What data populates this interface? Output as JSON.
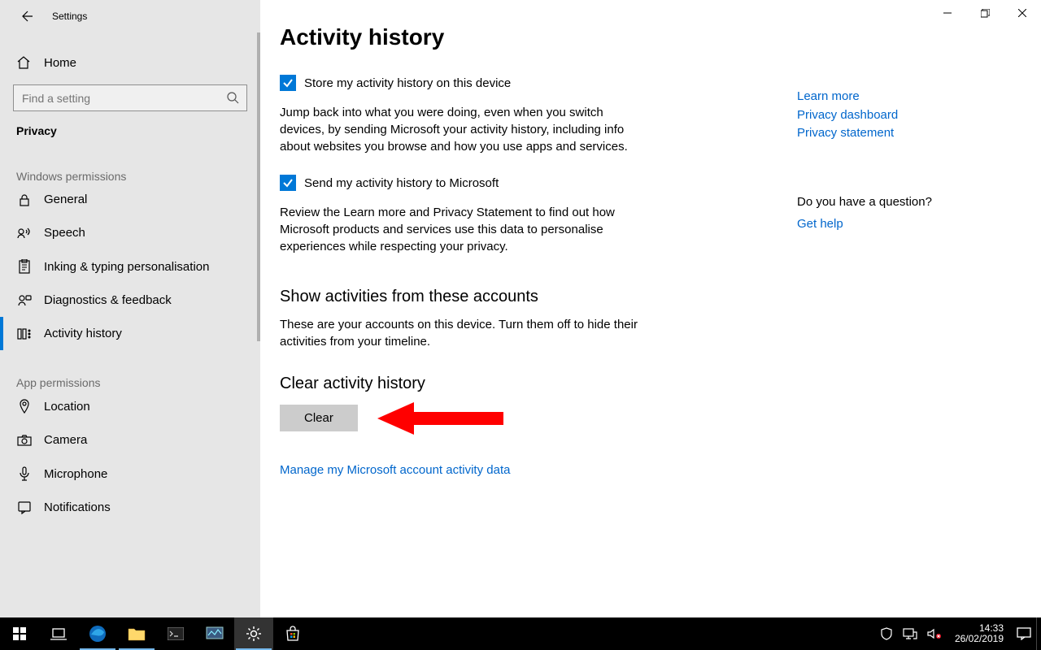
{
  "window": {
    "app_name": "Settings"
  },
  "sidebar": {
    "home_label": "Home",
    "search_placeholder": "Find a setting",
    "current_category": "Privacy",
    "sections": {
      "windows_permissions": {
        "header": "Windows permissions",
        "items": [
          {
            "id": "general",
            "label": "General"
          },
          {
            "id": "speech",
            "label": "Speech"
          },
          {
            "id": "inking",
            "label": "Inking & typing personalisation"
          },
          {
            "id": "diagnostics",
            "label": "Diagnostics & feedback"
          },
          {
            "id": "activity",
            "label": "Activity history",
            "selected": true
          }
        ]
      },
      "app_permissions": {
        "header": "App permissions",
        "items": [
          {
            "id": "location",
            "label": "Location"
          },
          {
            "id": "camera",
            "label": "Camera"
          },
          {
            "id": "microphone",
            "label": "Microphone"
          },
          {
            "id": "notifications",
            "label": "Notifications"
          }
        ]
      }
    }
  },
  "main": {
    "title": "Activity history",
    "checkbox1_label": "Store my activity history on this device",
    "checkbox1_checked": true,
    "desc1": "Jump back into what you were doing, even when you switch devices, by sending Microsoft your activity history, including info about websites you browse and how you use apps and services.",
    "checkbox2_label": "Send my activity history to Microsoft",
    "checkbox2_checked": true,
    "desc2": "Review the Learn more and Privacy Statement to find out how Microsoft products and services use this data to personalise experiences while respecting your privacy.",
    "accounts_header": "Show activities from these accounts",
    "accounts_desc": "These are your accounts on this device. Turn them off to hide their activities from your timeline.",
    "clear_header": "Clear activity history",
    "clear_button": "Clear",
    "manage_link": "Manage my Microsoft account activity data"
  },
  "right": {
    "links": {
      "learn_more": "Learn more",
      "privacy_dashboard": "Privacy dashboard",
      "privacy_statement": "Privacy statement"
    },
    "question_header": "Do you have a question?",
    "get_help": "Get help"
  },
  "taskbar": {
    "time": "14:33",
    "date": "26/02/2019"
  }
}
